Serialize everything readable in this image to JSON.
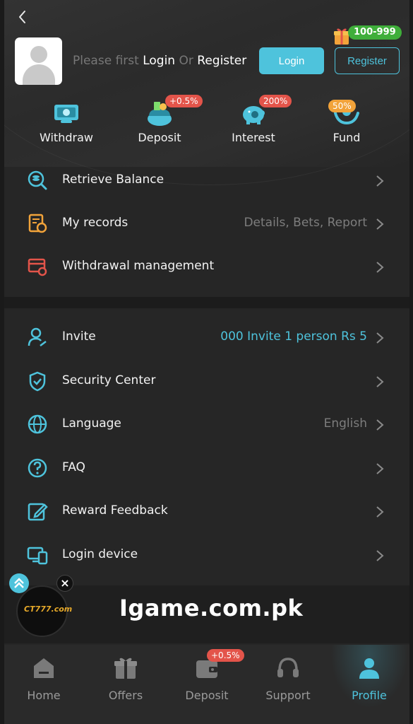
{
  "header": {
    "prompt_prefix": "Please first",
    "prompt_login": "Login",
    "prompt_or": "Or",
    "prompt_register": "Register",
    "login_button": "Login",
    "register_button": "Register",
    "register_bonus_badge": "100-999"
  },
  "quick_actions": [
    {
      "label": "Withdraw",
      "icon": "withdraw-icon",
      "badge": ""
    },
    {
      "label": "Deposit",
      "icon": "wallet-coins-icon",
      "badge": "+0.5%"
    },
    {
      "label": "Interest",
      "icon": "piggy-bank-icon",
      "badge": "200%"
    },
    {
      "label": "Fund",
      "icon": "fund-hands-icon",
      "badge": "50%"
    }
  ],
  "menu_group_1": [
    {
      "label": "Retrieve Balance",
      "value": "",
      "icon": "search-coin-icon"
    },
    {
      "label": "My records",
      "value": "Details, Bets, Report",
      "icon": "records-icon"
    },
    {
      "label": "Withdrawal management",
      "value": "",
      "icon": "card-settings-icon"
    }
  ],
  "menu_group_2": [
    {
      "label": "Invite",
      "value": "000  Invite 1 person Rs 5",
      "icon": "invite-user-icon"
    },
    {
      "label": "Security Center",
      "value": "",
      "icon": "shield-check-icon"
    },
    {
      "label": "Language",
      "value": "English",
      "icon": "globe-icon"
    },
    {
      "label": "FAQ",
      "value": "",
      "icon": "question-icon"
    },
    {
      "label": "Reward Feedback",
      "value": "",
      "icon": "edit-icon"
    },
    {
      "label": "Login device",
      "value": "",
      "icon": "devices-icon"
    }
  ],
  "banner": {
    "text": "Igame.com.pk",
    "logo_text": "CT777.com"
  },
  "tabbar": [
    {
      "label": "Home",
      "icon": "home-icon",
      "active": false,
      "badge": ""
    },
    {
      "label": "Offers",
      "icon": "gift-icon",
      "active": false,
      "badge": ""
    },
    {
      "label": "Deposit",
      "icon": "wallet-icon",
      "active": false,
      "badge": "+0.5%"
    },
    {
      "label": "Support",
      "icon": "headset-icon",
      "active": false,
      "badge": ""
    },
    {
      "label": "Profile",
      "icon": "profile-icon",
      "active": true,
      "badge": ""
    }
  ],
  "colors": {
    "accent": "#4ec3dc",
    "badge_red": "#e3544a",
    "badge_green": "#3fae3a",
    "background": "#262626"
  }
}
